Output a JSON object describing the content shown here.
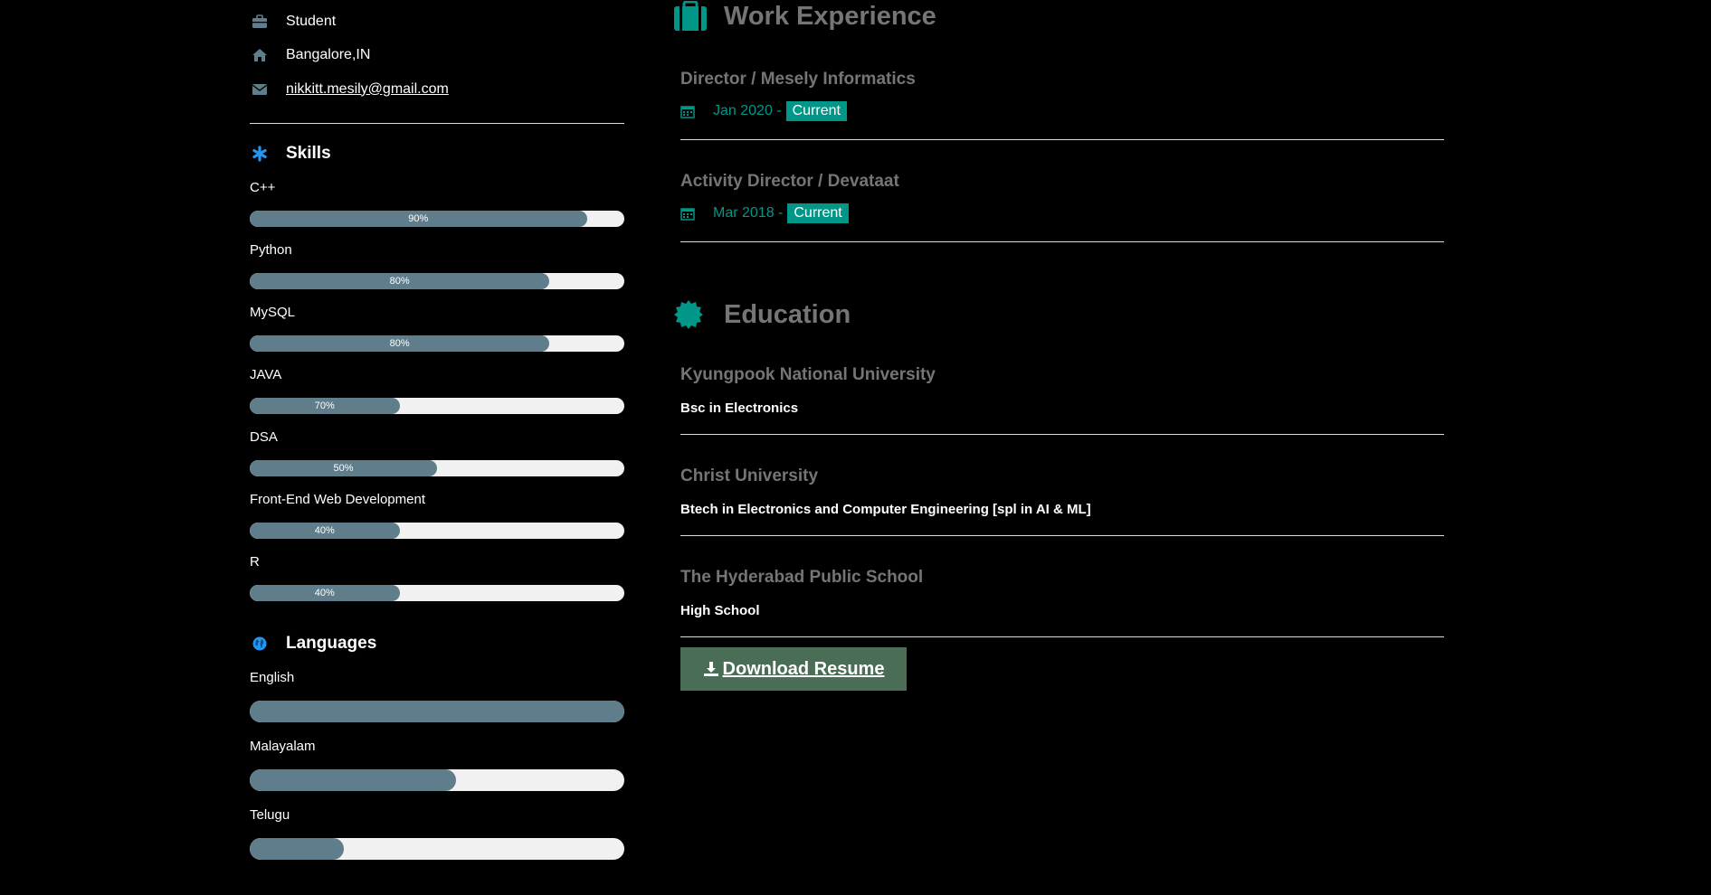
{
  "contact": {
    "role": "Student",
    "location": "Bangalore,IN",
    "email": "nikkitt.mesily@gmail.com"
  },
  "skills": {
    "title": "Skills",
    "items": [
      {
        "name": "C++",
        "percent": 90,
        "label": "90%"
      },
      {
        "name": "Python",
        "percent": 80,
        "label": "80%"
      },
      {
        "name": "MySQL",
        "percent": 80,
        "label": "80%"
      },
      {
        "name": "JAVA",
        "percent": 40,
        "label": "70%"
      },
      {
        "name": "DSA",
        "percent": 50,
        "label": "50%"
      },
      {
        "name": "Front-End Web Development",
        "percent": 40,
        "label": "40%"
      },
      {
        "name": "R",
        "percent": 40,
        "label": "40%"
      }
    ]
  },
  "languages": {
    "title": "Languages",
    "items": [
      {
        "name": "English",
        "percent": 100
      },
      {
        "name": "Malayalam",
        "percent": 55
      },
      {
        "name": "Telugu",
        "percent": 25
      }
    ]
  },
  "work": {
    "title": "Work Experience",
    "entries": [
      {
        "title": "Director / Mesely Informatics",
        "date": "Jan 2020 -",
        "tag": "Current"
      },
      {
        "title": "Activity Director / Devataat",
        "date": "Mar 2018 -",
        "tag": "Current"
      }
    ]
  },
  "education": {
    "title": "Education",
    "entries": [
      {
        "school": "Kyungpook National University",
        "degree": "Bsc in Electronics"
      },
      {
        "school": "Christ University",
        "degree": "Btech in Electronics and Computer Engineering [spl in AI & ML]"
      },
      {
        "school": "The Hyderabad Public School",
        "degree": "High School"
      }
    ]
  },
  "download_label": "Download Resume",
  "colors": {
    "teal": "#009688",
    "bar_fill": "#607d8b",
    "bar_track": "#f1f1f1",
    "heading_grey": "#757575",
    "download_bg": "#4a6d55",
    "icon_blue": "#2196f3"
  },
  "icons": {
    "role": "briefcase-icon",
    "location": "home-icon",
    "email": "envelope-icon",
    "skills": "asterisk-icon",
    "languages": "globe-icon",
    "work": "suitcase-icon",
    "education": "certificate-icon",
    "date": "calendar-icon",
    "download": "download-icon"
  }
}
